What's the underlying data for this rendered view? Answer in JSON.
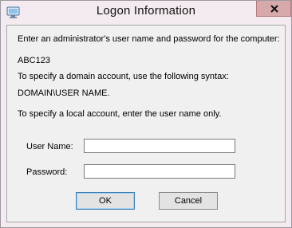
{
  "window": {
    "title": "Logon Information",
    "close_icon": "close-icon",
    "app_icon": "computer-icon"
  },
  "content": {
    "instruction": "Enter an administrator's user name and password for the computer:",
    "computer_name": "ABC123",
    "domain_hint": "To specify a domain account, use the following syntax:",
    "domain_syntax": "DOMAIN\\USER NAME.",
    "local_hint": "To specify a local account, enter the user name only."
  },
  "form": {
    "username_label": "User Name:",
    "username_value": "",
    "password_label": "Password:",
    "password_value": ""
  },
  "buttons": {
    "ok_label": "OK",
    "cancel_label": "Cancel"
  },
  "colors": {
    "frame": "#f3ebef",
    "client": "#f0f0f0",
    "close_button": "#d7a9ab"
  }
}
